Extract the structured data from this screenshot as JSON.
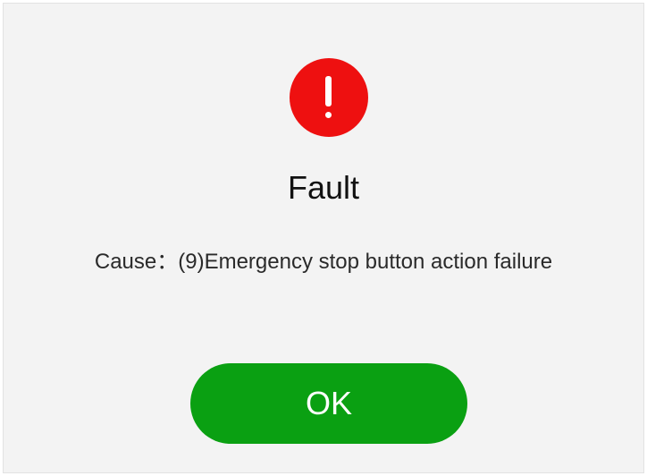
{
  "dialog": {
    "icon": "error-exclamation-icon",
    "title": "Fault",
    "cause_label": "Cause：",
    "cause_text": "(9)Emergency stop button action failure",
    "ok_label": "OK"
  },
  "colors": {
    "background": "#f3f3f3",
    "error_icon": "#ee1010",
    "ok_button": "#0aa012",
    "ok_text": "#ffffff"
  }
}
